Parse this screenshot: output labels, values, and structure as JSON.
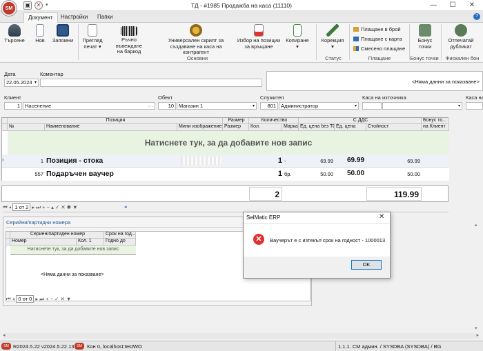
{
  "window": {
    "title": "ТД - #1985 Продажба на каса (11110)",
    "logo_text": "SM",
    "controls": [
      "—",
      "☐",
      "✕"
    ]
  },
  "ribbon_tabs": [
    "Документ",
    "Настройки",
    "Папки"
  ],
  "ribbon": {
    "buttons": {
      "search": "Търсене",
      "new": "Нов",
      "save": "Запомни",
      "preview_line1": "Преглед",
      "preview_line2": "печат ▾",
      "barcode_line1": "Ръчно въвеждане",
      "barcode_line2": "на баркод",
      "script_line1": "Универсален скрипт за",
      "script_line2": "създаване на каса на контрагент",
      "return_line1": "Избор на позиции",
      "return_line2": "за връщане",
      "copy_line1": "Копиране",
      "copy_line2": "▾",
      "correction_line1": "Корекция",
      "correction_line2": "▾",
      "bonus_line1": "Бонус",
      "bonus_line2": "точки",
      "print_dup_line1": "Отпечатай",
      "print_dup_line2": "дубликат"
    },
    "payments": [
      "Плащане в брой",
      "Плащане с карта",
      "Смесено плащане"
    ],
    "groups": {
      "main": "Основни",
      "status": "Статус",
      "payment": "Плащане",
      "bonus": "Бонус точки",
      "fiscal": "Фискален бон"
    }
  },
  "header_form": {
    "date_label": "Дата",
    "date_value": "22.05.2024",
    "comment_label": "Коментар",
    "no_data": "<Няма данни за показване>",
    "client_label": "Клиент",
    "client_code": "1",
    "client_name": "Население",
    "object_label": "Обект",
    "object_code": "10",
    "object_name": "Магазин 1",
    "employee_label": "Служител",
    "employee_code": "801",
    "employee_name": "Администратор",
    "source_register_label": "Каса на източника",
    "register_label": "Каса на получа"
  },
  "main_grid": {
    "bands": [
      "Позиция",
      "Размер",
      "Количество",
      "С ДДС",
      "Бонус то..."
    ],
    "columns": [
      "№",
      "Наименование",
      "Мини изображение",
      "Размер",
      "Кол.",
      "Марка",
      "Ед. цена без ТО",
      "Ед. цена",
      "Стойност",
      "на Клиент"
    ],
    "add_row": "Натиснете тук, за да добавите нов запис",
    "rows": [
      {
        "num": "1",
        "name": "Позиция - стока",
        "qty": "1",
        "unit": "-",
        "price_no_disc": "69.99",
        "price": "69.99",
        "value": "69.99"
      },
      {
        "num": "557",
        "name": "Подаръчен ваучер",
        "qty": "1",
        "unit": "бр.",
        "price_no_disc": "50.00",
        "price": "50.00",
        "value": "50.00"
      }
    ],
    "total_qty": "2",
    "total_value": "119.99",
    "nav_text": "1 от 2"
  },
  "serial_panel": {
    "title": "Серийни/партидни номера",
    "band1": "Сериен/партиден номер",
    "band2": "Срок на год...",
    "cols": [
      "Номер",
      "Кол. 1",
      "Годно до"
    ],
    "add_row": "Натиснете тук, за да добавите нов запис",
    "no_data": "<Няма данни за показване>",
    "nav_text": "0 от 0"
  },
  "dialog": {
    "title": "SelMatic ERP",
    "message": "Ваучерът е с изтекъл срок на годност - 1000013",
    "ok": "OK"
  },
  "statusbar": {
    "version": "R2024.5.22 v2024.5.22.13",
    "connection": "Кон 0, localhost:testWO",
    "user": "1.1.1. СМ админ. / SYSDBA (SYSDBA) / BG"
  },
  "colors": {
    "accent_red": "#c0392b",
    "add_row_bg": "#e8f3e2",
    "error_icon": "#e03030"
  }
}
